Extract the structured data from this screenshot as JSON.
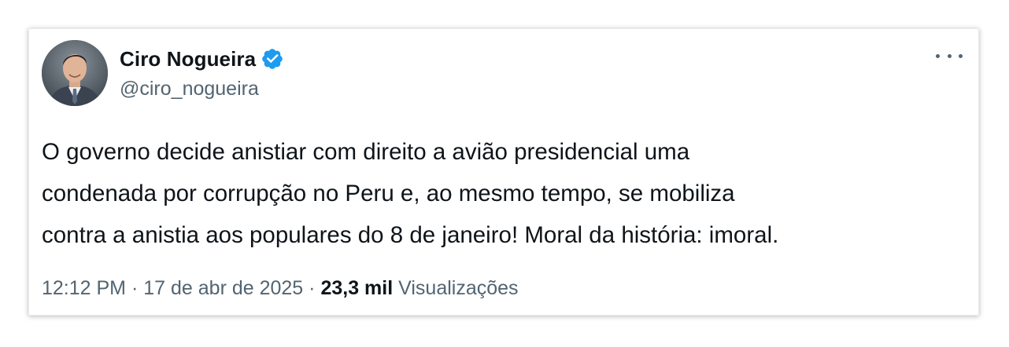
{
  "tweet": {
    "author": {
      "display_name": "Ciro Nogueira",
      "handle": "@ciro_nogueira",
      "verified_icon": "verified-badge-icon",
      "verified_color": "#1d9bf0"
    },
    "text": "O governo decide anistiar com direito a avião presidencial uma\ncondenada por corrupção no Peru e, ao mesmo tempo, se mobiliza\ncontra a anistia aos populares do 8 de janeiro! Moral da história: imoral.",
    "time": "12:12 PM",
    "separator": "·",
    "date": "17 de abr de 2025",
    "views_count": "23,3 mil",
    "views_label": "Visualizações",
    "more_icon": "more-horizontal-icon"
  },
  "colors": {
    "primary_text": "#0f1419",
    "secondary_text": "#536471",
    "accent": "#1d9bf0"
  }
}
